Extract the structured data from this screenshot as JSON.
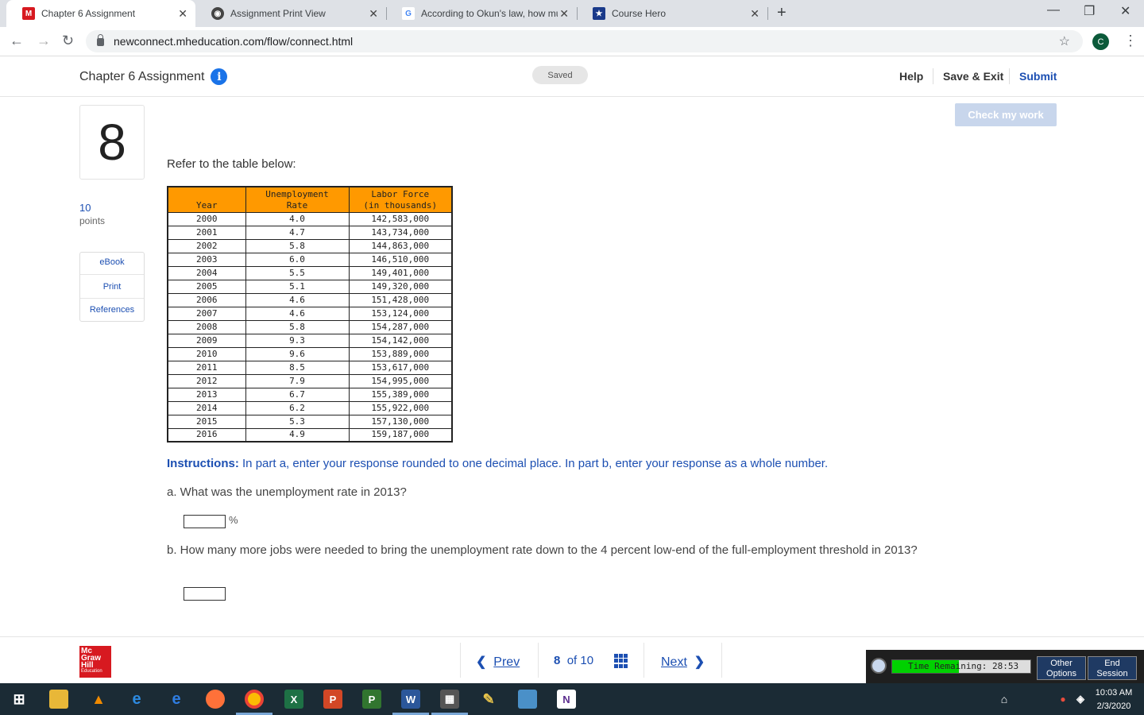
{
  "browser": {
    "tabs": [
      {
        "title": "Chapter 6 Assignment"
      },
      {
        "title": "Assignment Print View"
      },
      {
        "title": "According to Okun's law, how mu"
      },
      {
        "title": "Course Hero"
      }
    ],
    "url": "newconnect.mheducation.com/flow/connect.html",
    "profile_initial": "C"
  },
  "header": {
    "title": "Chapter 6 Assignment",
    "status": "Saved",
    "help": "Help",
    "save_exit": "Save & Exit",
    "submit": "Submit"
  },
  "question": {
    "number": "8",
    "points_value": "10",
    "points_label": "points",
    "check_my_work": "Check my work",
    "prompt": "Refer to the table below:",
    "table": {
      "headers": [
        [
          "Year"
        ],
        [
          "Unemployment",
          "Rate"
        ],
        [
          "Labor Force",
          "(in thousands)"
        ]
      ],
      "rows": [
        [
          "2000",
          "4.0",
          "142,583,000"
        ],
        [
          "2001",
          "4.7",
          "143,734,000"
        ],
        [
          "2002",
          "5.8",
          "144,863,000"
        ],
        [
          "2003",
          "6.0",
          "146,510,000"
        ],
        [
          "2004",
          "5.5",
          "149,401,000"
        ],
        [
          "2005",
          "5.1",
          "149,320,000"
        ],
        [
          "2006",
          "4.6",
          "151,428,000"
        ],
        [
          "2007",
          "4.6",
          "153,124,000"
        ],
        [
          "2008",
          "5.8",
          "154,287,000"
        ],
        [
          "2009",
          "9.3",
          "154,142,000"
        ],
        [
          "2010",
          "9.6",
          "153,889,000"
        ],
        [
          "2011",
          "8.5",
          "153,617,000"
        ],
        [
          "2012",
          "7.9",
          "154,995,000"
        ],
        [
          "2013",
          "6.7",
          "155,389,000"
        ],
        [
          "2014",
          "6.2",
          "155,922,000"
        ],
        [
          "2015",
          "5.3",
          "157,130,000"
        ],
        [
          "2016",
          "4.9",
          "159,187,000"
        ]
      ]
    },
    "instructions_label": "Instructions:",
    "instructions_text": " In part a, enter your response rounded to one decimal place. In part b, enter your response as a whole number.",
    "part_a": "a. What was the unemployment rate in 2013?",
    "part_a_unit": "%",
    "part_b": "b. How many more jobs were needed to bring the unemployment rate down to the 4 percent low-end of the full-employment threshold in 2013?"
  },
  "sidebar": {
    "links": [
      "eBook",
      "Print",
      "References"
    ]
  },
  "footer": {
    "logo_lines": [
      "Mc",
      "Graw",
      "Hill"
    ],
    "logo_sub": "Education",
    "prev": "Prev",
    "current": "8",
    "of_text": "of 10",
    "next": "Next"
  },
  "timer": {
    "text": "Time Remaining: 28:53",
    "fill_fraction": 0.48,
    "other_options": [
      "Other",
      "Options"
    ],
    "end_session": [
      "End",
      "Session"
    ]
  },
  "taskbar": {
    "time": "10:03 AM",
    "date": "2/3/2020"
  },
  "colors": {
    "accent_blue": "#1c4fb2",
    "table_header": "#ff9900",
    "brand_red": "#d71920"
  }
}
